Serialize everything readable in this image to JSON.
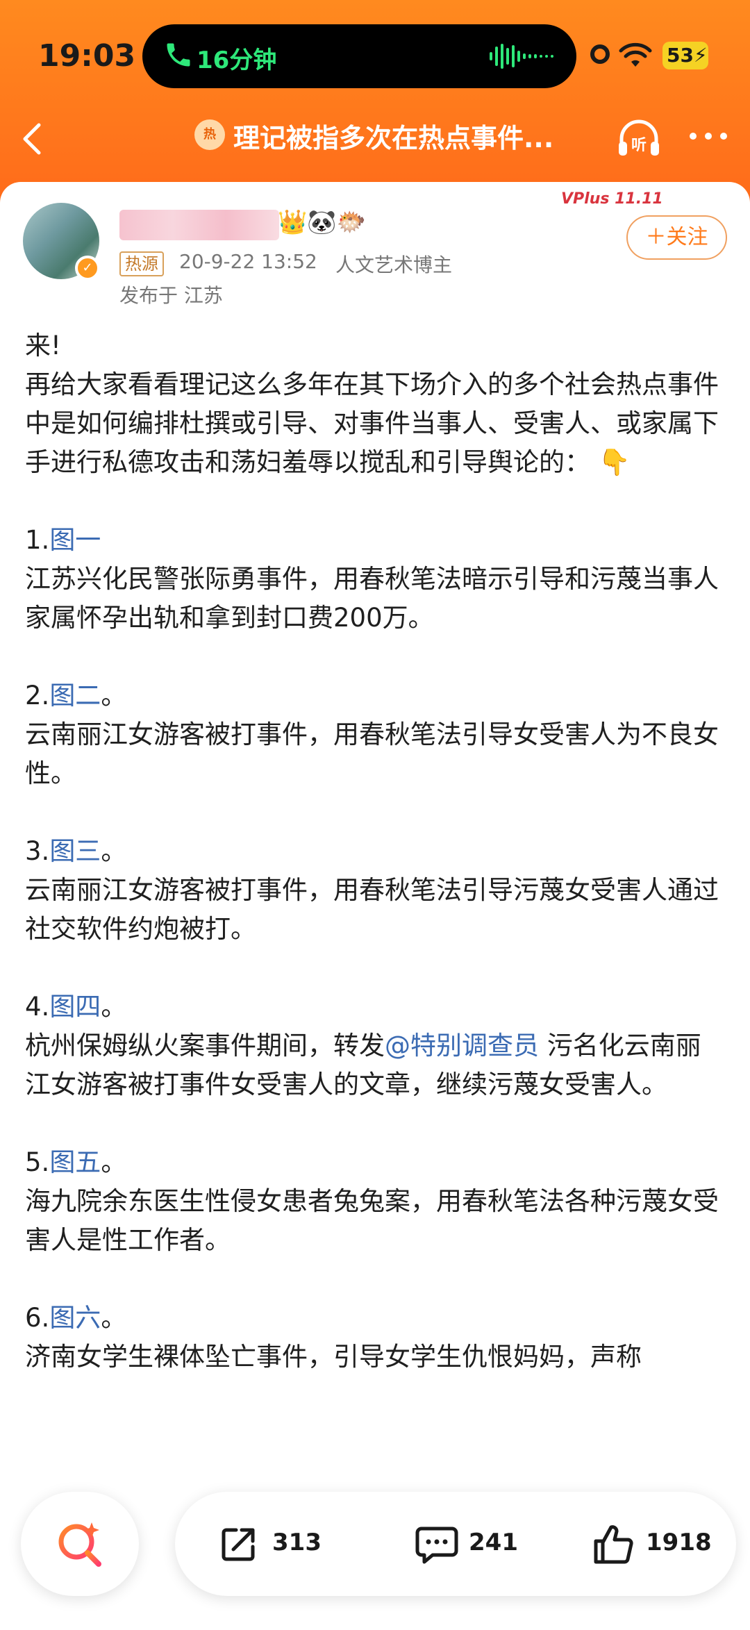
{
  "status_bar": {
    "time": "19:03",
    "call_duration": "16分钟",
    "battery": "53"
  },
  "nav": {
    "hot_badge": "热",
    "title": "理记被指多次在热点事件..."
  },
  "post": {
    "source_badge": "热源",
    "timestamp": "20-9-22 13:52",
    "author_role": "人文艺术博主",
    "location": "发布于 江苏",
    "follow_label": "＋关注",
    "vplus_label": "VPlus 11.11",
    "paragraphs": {
      "p0": "来!",
      "p1": "再给大家看看理记这么多年在其下场介入的多个社会热点事件中是如何编排杜撰或引导、对事件当事人、受害人、或家属下手进行私德攻击和荡妇羞辱以搅乱和引导舆论的：",
      "p1_emoji": "👇",
      "i1_num": "1.",
      "i1_link": "图一",
      "i1_text": "江苏兴化民警张际勇事件，用春秋笔法暗示引导和污蔑当事人家属怀孕出轨和拿到封口费200万。",
      "i2_num": "2.",
      "i2_link": "图二",
      "i2_suffix": "。",
      "i2_text": "云南丽江女游客被打事件，用春秋笔法引导女受害人为不良女性。",
      "i3_num": "3.",
      "i3_link": "图三",
      "i3_suffix": "。",
      "i3_text": "云南丽江女游客被打事件，用春秋笔法引导污蔑女受害人通过社交软件约炮被打。",
      "i4_num": "4.",
      "i4_link": "图四",
      "i4_suffix": "。",
      "i4_text_a": "杭州保姆纵火案事件期间，转发",
      "i4_mention": "@特别调查员",
      "i4_text_b": " 污名化云南丽江女游客被打事件女受害人的文章，继续污蔑女受害人。",
      "i5_num": "5.",
      "i5_link": "图五",
      "i5_suffix": "。",
      "i5_text": "海九院余东医生性侵女患者兔兔案，用春秋笔法各种污蔑女受害人是性工作者。",
      "i6_num": "6.",
      "i6_link": "图六",
      "i6_suffix": "。",
      "i6_text": "济南女学生裸体坠亡事件，引导女学生仇恨妈妈，声称"
    }
  },
  "actions": {
    "share_count": "313",
    "comment_count": "241",
    "like_count": "1918"
  },
  "icons": {
    "back": "chevron-left-icon",
    "listen": "headphones-icon",
    "more": "more-horizontal-icon",
    "search": "search-sparkle-icon",
    "share": "share-icon",
    "comment": "comment-icon",
    "like": "thumbs-up-icon"
  },
  "colors": {
    "header_orange": "#ff7a1a",
    "link_blue": "#3b6bb3",
    "call_green": "#2ee87a",
    "battery_yellow": "#f5d224"
  }
}
